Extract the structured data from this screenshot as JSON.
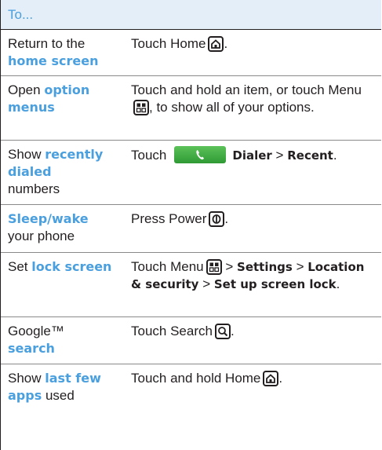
{
  "header": {
    "text": "To..."
  },
  "rows": [
    {
      "c1a": "Return to the",
      "c1b": "home screen",
      "c2a": "Touch Home",
      "c2b": "."
    },
    {
      "c1a": "Open",
      "c1b": "option menus",
      "c2a": "Touch and hold an item, or touch Menu",
      "c2b": ", to show all of your options."
    },
    {
      "c1a": "Show",
      "c1b": "recently dialed",
      "c1c": "numbers",
      "c2a": "Touch",
      "c2b": "Dialer",
      "c2c": ">",
      "c2d": "Recent",
      "c2e": "."
    },
    {
      "c1a": "Sleep/wake",
      "c1b": "your phone",
      "c2a": "Press Power",
      "c2b": "."
    },
    {
      "c1a": "Set",
      "c1b": "lock screen",
      "c2a": "Touch Menu",
      "c2b": ">",
      "c2c": "Settings",
      "c2d": ">",
      "c2e": "Location & security",
      "c2f": ">",
      "c2g": "Set up screen lock",
      "c2h": "."
    },
    {
      "c1a": "Google™",
      "c1b": "search",
      "c2a": "Touch Search",
      "c2b": "."
    },
    {
      "c1a": "Show",
      "c1b": "last few apps",
      "c1c": "used",
      "c2a": "Touch and hold Home",
      "c2b": "."
    }
  ],
  "icons": {
    "home": "home-key-icon",
    "menu": "menu-key-icon",
    "power": "power-key-icon",
    "search": "search-key-icon",
    "phone": "phone-icon"
  },
  "colors": {
    "accent": "#4a9fde",
    "header_bg": "#e3eef8",
    "dialer_green": "#3aa83d"
  }
}
